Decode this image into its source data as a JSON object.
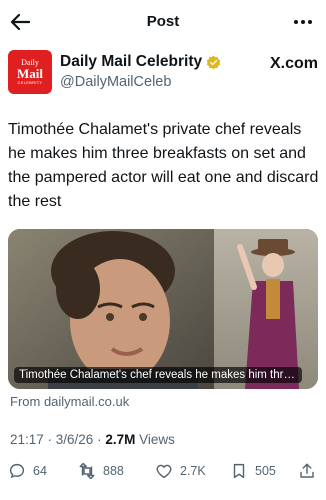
{
  "topbar": {
    "title": "Post"
  },
  "author": {
    "display_name": "Daily Mail Celebrity",
    "handle": "@DailyMailCeleb",
    "avatar": {
      "line1": "Daily",
      "line2": "Mail",
      "line3": "CELEBRITY"
    }
  },
  "brand": {
    "site": "X.com"
  },
  "tweet": {
    "text": "Timothée Chalamet's private chef reveals he makes him three breakfasts on set and the pampered actor will eat one and discard the rest"
  },
  "card": {
    "caption": "Timothée Chalamet's chef reveals he makes him three bre...",
    "source": "From dailymail.co.uk"
  },
  "meta": {
    "time_date": "21:17 · 3/6/26 · ",
    "views_count": "2.7M",
    "views_label": " Views"
  },
  "actions": {
    "replies": "64",
    "reposts": "888",
    "likes": "2.7K",
    "bookmarks": "505"
  },
  "colors": {
    "accent_red": "#e02020",
    "muted": "#536471",
    "text": "#0f1419",
    "verified_gold": "#e2b719"
  },
  "icons": [
    "back-arrow-icon",
    "more-icon",
    "verified-badge-icon",
    "reply-icon",
    "repost-icon",
    "like-icon",
    "bookmark-icon",
    "share-icon"
  ]
}
